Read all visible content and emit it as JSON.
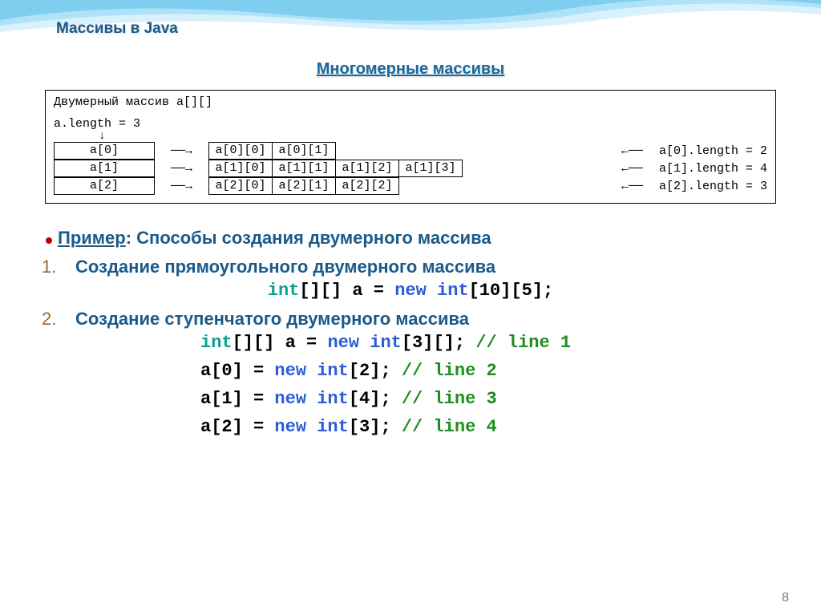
{
  "breadcrumb": "Массивы в Java",
  "section_title": "Многомерные массивы",
  "diagram": {
    "title": "Двумерный массив a[][]",
    "len_expr": "a.length = 3",
    "rows": [
      {
        "left": "a[0]",
        "cells": [
          "a[0][0]",
          "a[0][1]"
        ],
        "right": "a[0].length = 2"
      },
      {
        "left": "a[1]",
        "cells": [
          "a[1][0]",
          "a[1][1]",
          "a[1][2]",
          "a[1][3]"
        ],
        "right": "a[1].length = 4"
      },
      {
        "left": "a[2]",
        "cells": [
          "a[2][0]",
          "a[2][1]",
          "a[2][2]"
        ],
        "right": "a[2].length = 3"
      }
    ]
  },
  "example": {
    "label": "Пример",
    "rest": ": Способы создания двумерного массива"
  },
  "item1": {
    "num": "1.",
    "heading": "Создание прямоугольного двумерного массива",
    "code": {
      "p1": "int",
      "p2": "[][] a = ",
      "p3": "new int",
      "p4": "[10][5];"
    }
  },
  "item2": {
    "num": "2.",
    "heading": "Создание ступенчатого двумерного массива",
    "lines": [
      {
        "p1": "int",
        "p2": "[][] a = ",
        "p3": "new int",
        "p4": "[3][]; ",
        "c": "// line 1"
      },
      {
        "p1": "",
        "p2": "a[0] = ",
        "p3": "new int",
        "p4": "[2]; ",
        "c": "// line 2"
      },
      {
        "p1": "",
        "p2": "a[1] = ",
        "p3": "new int",
        "p4": "[4]; ",
        "c": "// line 3"
      },
      {
        "p1": "",
        "p2": "a[2] = ",
        "p3": "new int",
        "p4": "[3]; ",
        "c": "// line 4"
      }
    ]
  },
  "page_number": "8"
}
